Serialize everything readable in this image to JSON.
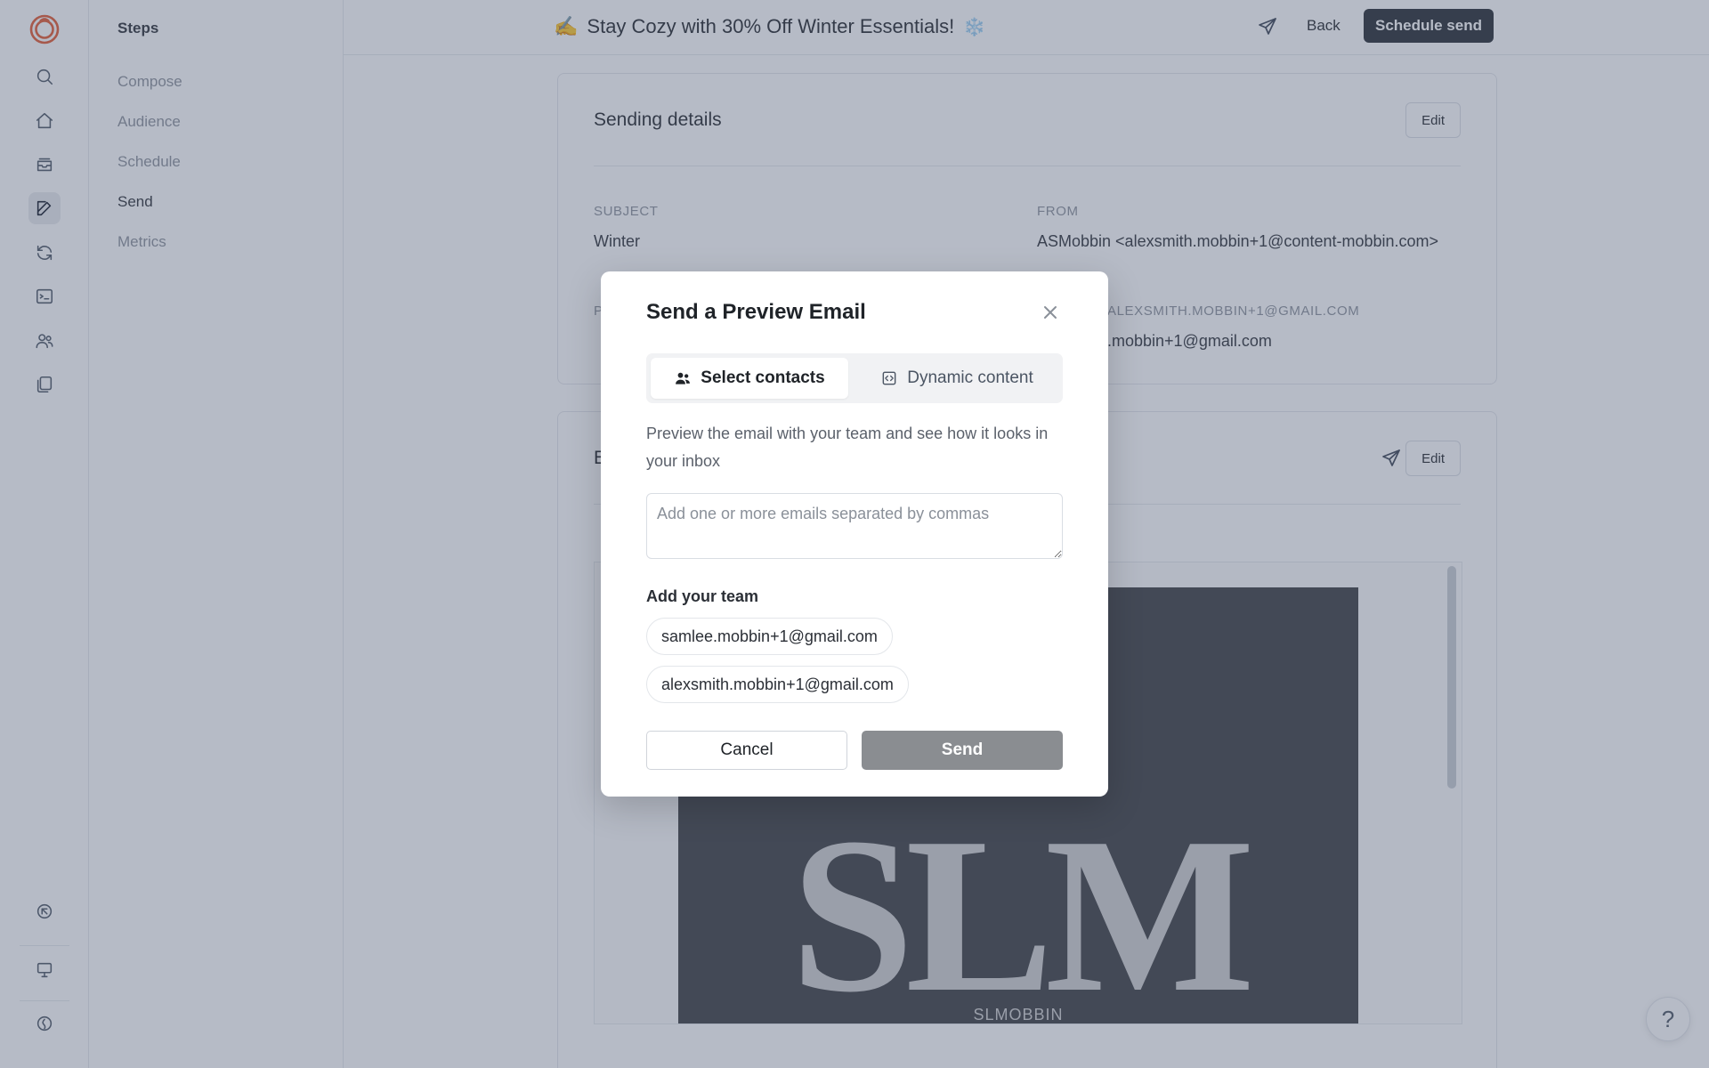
{
  "steps": {
    "heading": "Steps",
    "items": [
      {
        "label": "Compose"
      },
      {
        "label": "Audience"
      },
      {
        "label": "Schedule"
      },
      {
        "label": "Send"
      },
      {
        "label": "Metrics"
      }
    ],
    "current": "Send"
  },
  "topbar": {
    "title_emoji": "✍️",
    "title": "Stay Cozy with 30% Off Winter Essentials!",
    "title_suffix": "❄️",
    "back_label": "Back",
    "schedule_label": "Schedule send"
  },
  "sending_details": {
    "title": "Sending details",
    "edit_label": "Edit",
    "subject_label": "SUBJECT",
    "subject_value": "Winter",
    "from_label": "FROM",
    "from_value": "ASMobbin <alexsmith.mobbin+1@content-mobbin.com>",
    "reply_label": "P",
    "reply_to_label": "ALEXSMITH.MOBBIN+1@GMAIL.COM",
    "reply_to_value": ".mobbin+1@gmail.com"
  },
  "email_section": {
    "title": "E",
    "edit_label": "Edit",
    "image_brand": "SLM",
    "image_caption": "SLMOBBIN"
  },
  "modal": {
    "title": "Send a Preview Email",
    "tabs": [
      {
        "label": "Select contacts",
        "icon": "users-icon",
        "selected": true
      },
      {
        "label": "Dynamic content",
        "icon": "code-box-icon",
        "selected": false
      }
    ],
    "description": "Preview the email with your team and see how it looks in your inbox",
    "emails_placeholder": "Add one or more emails separated by commas",
    "emails_value": "",
    "team_label": "Add your team",
    "team": [
      {
        "email": "samlee.mobbin+1@gmail.com"
      },
      {
        "email": "alexsmith.mobbin+1@gmail.com"
      }
    ],
    "cancel_label": "Cancel",
    "send_label": "Send"
  },
  "help_label": "?",
  "colors": {
    "overlay": "#525d76",
    "primary_dark": "#24292f",
    "send_disabled": "#8a8d91",
    "logo": "#e4572e"
  }
}
